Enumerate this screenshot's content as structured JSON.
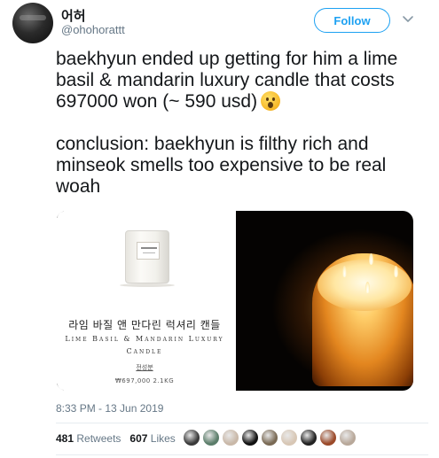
{
  "user": {
    "display_name": "어허",
    "handle": "@ohohorattt",
    "follow_label": "Follow"
  },
  "tweet": {
    "paragraph_1": "baekhyun ended up getting for him a lime basil & mandarin luxury candle that costs 697000 won (~ 590 usd)",
    "emoji": "hushed-face-emoji",
    "paragraph_2": "conclusion: baekhyun is filthy rich and minseok smells too expensive to be real woah",
    "timestamp": "8:33 PM - 13 Jun 2019"
  },
  "media": {
    "product": {
      "name_kr": "라임 바질 앤 만다린 럭셔리 캔들",
      "name_en_line1": "Lime Basil & Mandarin Luxury",
      "name_en_line2": "Candle",
      "sub_label": "전성분",
      "price": "₩697,000 2.1KG"
    }
  },
  "stats": {
    "retweets_count": "481",
    "retweets_label": "Retweets",
    "likes_count": "607",
    "likes_label": "Likes"
  },
  "likers": [
    "#3a3a3a",
    "#5b7d6a",
    "#c9b8a8",
    "#111111",
    "#7a6a55",
    "#d8c7b5",
    "#222222",
    "#9b4a2a",
    "#b8a89a"
  ],
  "colors": {
    "accent": "#1da1f2",
    "muted": "#657786",
    "text": "#14171a"
  }
}
